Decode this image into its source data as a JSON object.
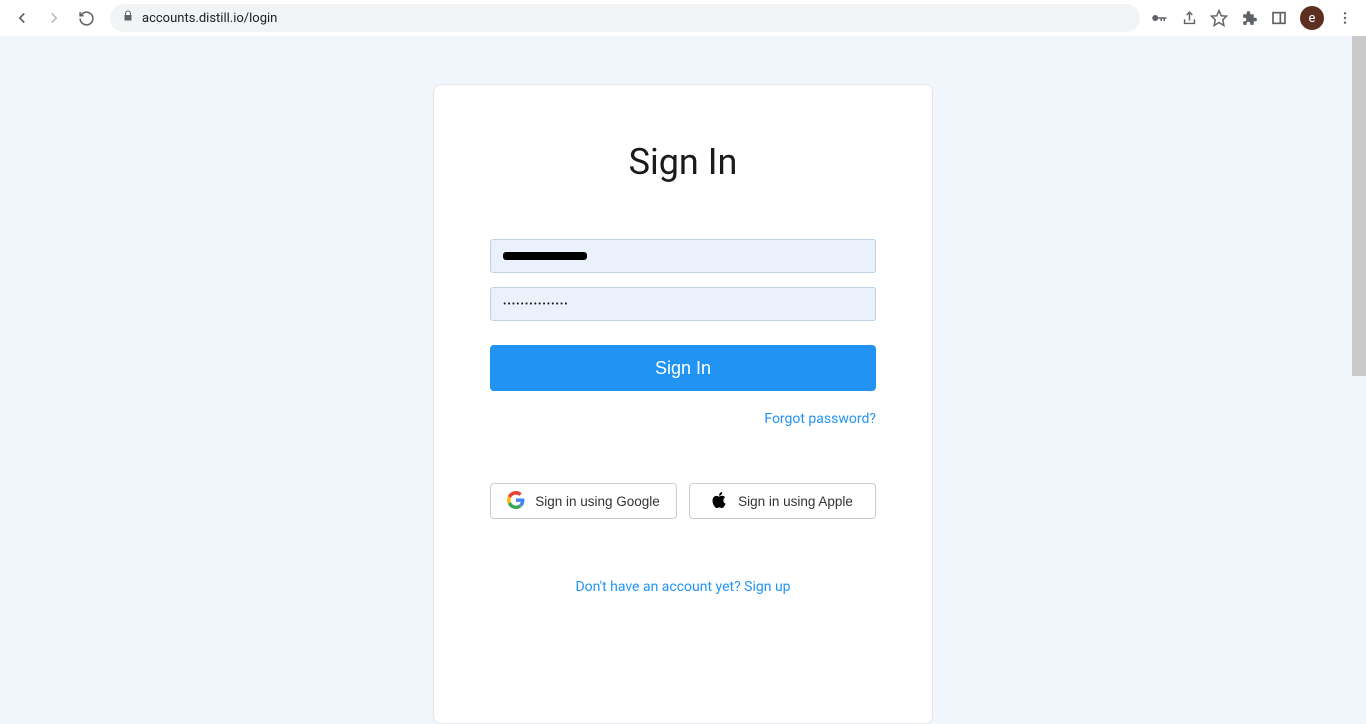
{
  "browser": {
    "url": "accounts.distill.io/login",
    "profile_initial": "e"
  },
  "page": {
    "title": "Sign In",
    "email_value": "redacted",
    "password_value": "•••••••••••••••",
    "submit_label": "Sign In",
    "forgot_label": "Forgot password?",
    "google_label": "Sign in using Google",
    "apple_label": "Sign in using Apple",
    "signup_prompt": "Don't have an account yet? Sign up"
  }
}
